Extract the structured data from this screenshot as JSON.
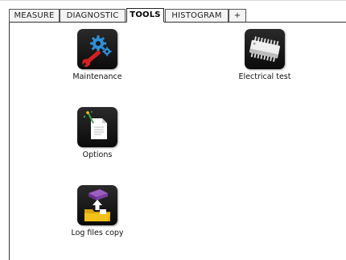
{
  "tabs": [
    {
      "id": "measure",
      "label": "MEASURE",
      "active": false
    },
    {
      "id": "diagnostic",
      "label": "DIAGNOSTIC",
      "active": false
    },
    {
      "id": "tools",
      "label": "TOOLS",
      "active": true
    },
    {
      "id": "histogram",
      "label": "HISTOGRAM",
      "active": false
    },
    {
      "id": "add",
      "label": "+",
      "active": false
    }
  ],
  "tools": {
    "maintenance": {
      "label": "Maintenance",
      "icon": "maintenance-gears-wrench-icon"
    },
    "electrical_test": {
      "label": "Electrical test",
      "icon": "chip-icon"
    },
    "options": {
      "label": "Options",
      "icon": "document-options-icon"
    },
    "log_files_copy": {
      "label": "Log files copy",
      "icon": "folder-copy-icon"
    }
  },
  "colors": {
    "icon_background": "#111111",
    "gear_blue": "#2f8fd6",
    "wrench_red": "#d42020",
    "folder_yellow": "#f2c21a",
    "database_purple": "#7a3fa0",
    "options_green": "#3aa63a"
  }
}
